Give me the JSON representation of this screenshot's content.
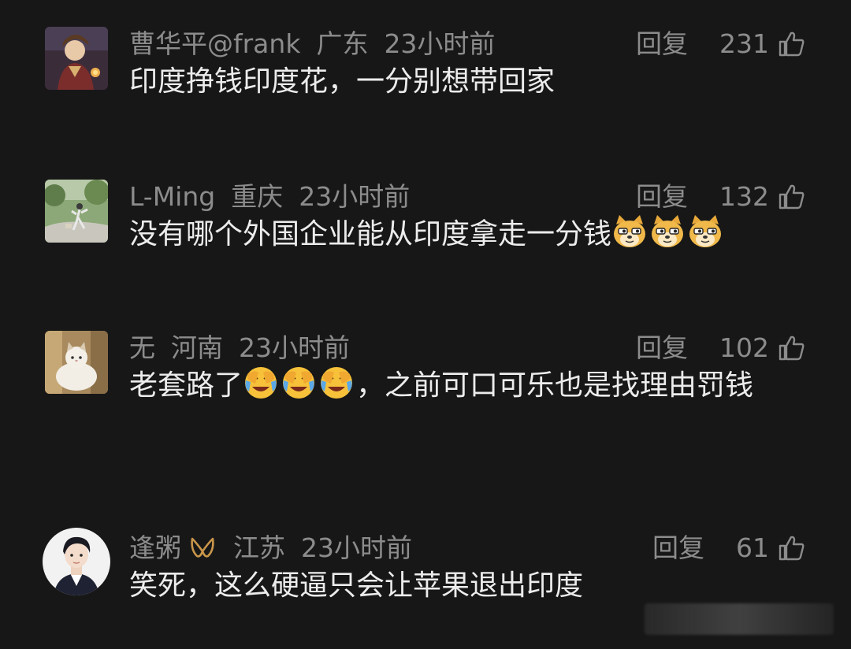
{
  "comments": [
    {
      "username": "曹华平@frank",
      "location": "广东",
      "time": "23小时前",
      "reply_label": "回复",
      "likes": "231",
      "text": "印度挣钱印度花，一分别想带回家",
      "emojis": []
    },
    {
      "username": "L-Ming",
      "location": "重庆",
      "time": "23小时前",
      "reply_label": "回复",
      "likes": "132",
      "text": "没有哪个外国企业能从印度拿走一分钱",
      "emojis": [
        "doge-emoji",
        "doge-emoji",
        "doge-emoji"
      ]
    },
    {
      "username": "无",
      "location": "河南",
      "time": "23小时前",
      "reply_label": "回复",
      "likes": "102",
      "text_before": "老套路了",
      "text_after": "，之前可口可乐也是找理由罚钱",
      "emojis": [
        "facepalm-laugh-emoji",
        "facepalm-laugh-emoji",
        "facepalm-laugh-emoji"
      ]
    },
    {
      "username": "逢粥",
      "location": "江苏",
      "time": "23小时前",
      "reply_label": "回复",
      "likes": "61",
      "text": "笑死，这么硬逼只会让苹果退出印度",
      "emojis": []
    }
  ],
  "icons": {
    "like": "thumbs-up-icon",
    "badge": "crown-badge-icon"
  },
  "colors": {
    "background": "#171717",
    "text": "#ececec",
    "meta": "#8c8c8c",
    "badge": "#c9964a"
  }
}
